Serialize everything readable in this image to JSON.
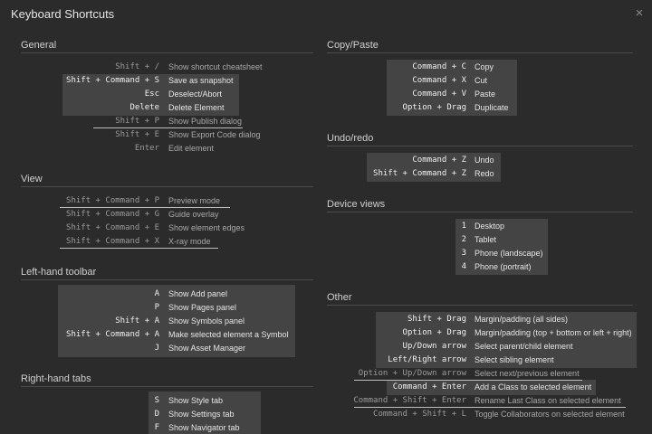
{
  "window": {
    "title": "Keyboard Shortcuts",
    "close_label": "×"
  },
  "sections": {
    "general": {
      "title": "General",
      "rows": [
        {
          "key": "Shift + /",
          "desc": "Show shortcut cheatsheet"
        },
        {
          "key": "Shift + Command + S",
          "desc": "Save as snapshot"
        },
        {
          "key": "Esc",
          "desc": "Deselect/Abort"
        },
        {
          "key": "Delete",
          "desc": "Delete Element"
        },
        {
          "key": "Shift + P",
          "desc": "Show Publish dialog"
        },
        {
          "key": "Shift + E",
          "desc": "Show Export Code dialog"
        },
        {
          "key": "Enter",
          "desc": "Edit element"
        }
      ]
    },
    "view": {
      "title": "View",
      "rows": [
        {
          "key": "Shift + Command + P",
          "desc": "Preview mode"
        },
        {
          "key": "Shift + Command + G",
          "desc": "Guide overlay"
        },
        {
          "key": "Shift + Command + E",
          "desc": "Show element edges"
        },
        {
          "key": "Shift + Command + X",
          "desc": "X-ray mode"
        }
      ]
    },
    "left_toolbar": {
      "title": "Left-hand toolbar",
      "rows": [
        {
          "key": "A",
          "desc": "Show Add panel"
        },
        {
          "key": "P",
          "desc": "Show Pages panel"
        },
        {
          "key": "Shift + A",
          "desc": "Show Symbols panel"
        },
        {
          "key": "Shift + Command + A",
          "desc": "Make selected element a Symbol"
        },
        {
          "key": "J",
          "desc": "Show Asset Manager"
        }
      ]
    },
    "right_tabs": {
      "title": "Right-hand tabs",
      "rows": [
        {
          "key": "S",
          "desc": "Show Style tab"
        },
        {
          "key": "D",
          "desc": "Show Settings tab"
        },
        {
          "key": "F",
          "desc": "Show Navigator tab"
        }
      ]
    },
    "copy_paste": {
      "title": "Copy/Paste",
      "rows": [
        {
          "key": "Command + C",
          "desc": "Copy"
        },
        {
          "key": "Command + X",
          "desc": "Cut"
        },
        {
          "key": "Command + V",
          "desc": "Paste"
        },
        {
          "key": "Option + Drag",
          "desc": "Duplicate"
        }
      ]
    },
    "undo_redo": {
      "title": "Undo/redo",
      "rows": [
        {
          "key": "Command + Z",
          "desc": "Undo"
        },
        {
          "key": "Shift + Command + Z",
          "desc": "Redo"
        }
      ]
    },
    "device_views": {
      "title": "Device views",
      "rows": [
        {
          "key": "1",
          "desc": "Desktop"
        },
        {
          "key": "2",
          "desc": "Tablet"
        },
        {
          "key": "3",
          "desc": "Phone (landscape)"
        },
        {
          "key": "4",
          "desc": "Phone (portrait)"
        }
      ]
    },
    "other": {
      "title": "Other",
      "rows": [
        {
          "key": "Shift + Drag",
          "desc": "Margin/padding (all sides)"
        },
        {
          "key": "Option + Drag",
          "desc": "Margin/padding (top + bottom or left + right)"
        },
        {
          "key": "Up/Down arrow",
          "desc": "Select parent/child element"
        },
        {
          "key": "Left/Right arrow",
          "desc": "Select sibling element"
        },
        {
          "key": "Option + Up/Down arrow",
          "desc": "Select next/previous element"
        },
        {
          "key": "Command + Enter",
          "desc": "Add a Class to selected element"
        },
        {
          "key": "Command + Shift + Enter",
          "desc": "Rename Last Class on selected element"
        },
        {
          "key": "Command + Shift + L",
          "desc": "Toggle Collaborators on selected element"
        }
      ]
    }
  }
}
